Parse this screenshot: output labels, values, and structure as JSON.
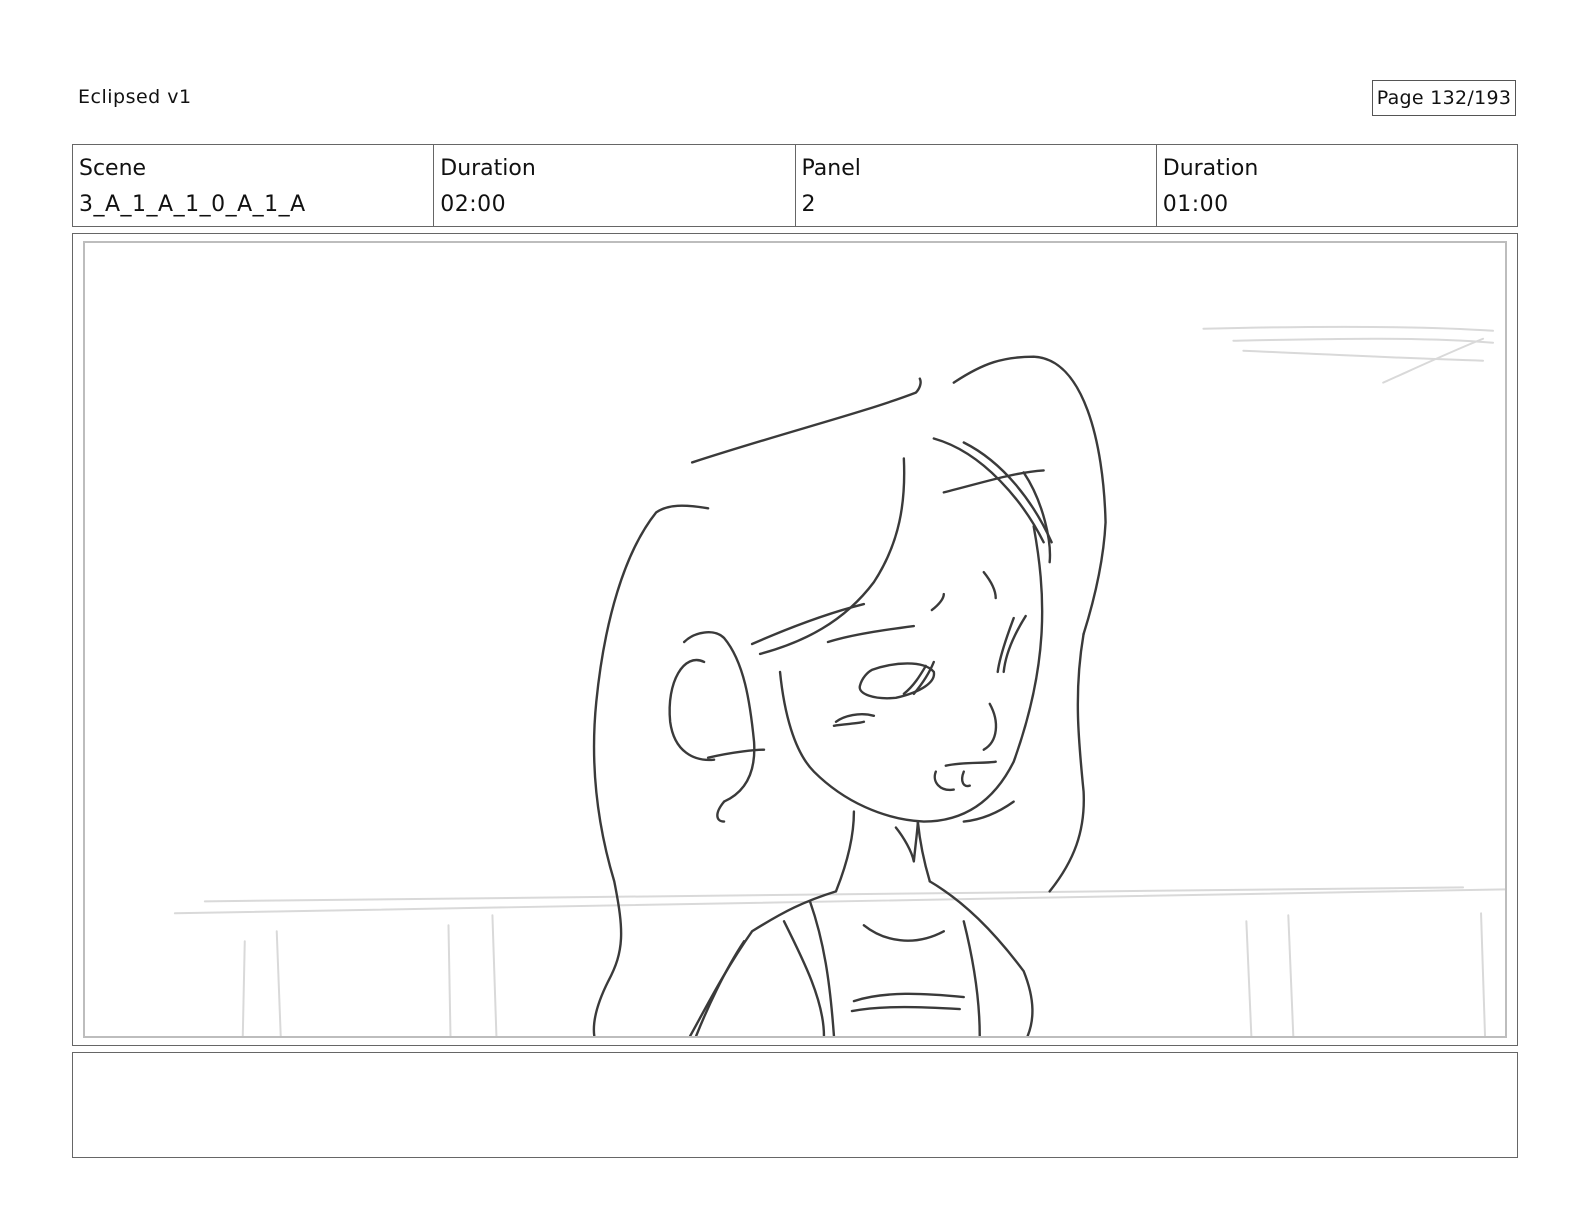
{
  "header": {
    "project_title": "Eclipsed v1",
    "page_indicator": "Page 132/193"
  },
  "info": {
    "scene_label": "Scene",
    "scene_value": "3_A_1_A_1_0_A_1_A",
    "scene_duration_label": "Duration",
    "scene_duration_value": "02:00",
    "panel_label": "Panel",
    "panel_value": "2",
    "panel_duration_label": "Duration",
    "panel_duration_value": "01:00"
  },
  "notes": {
    "text": ""
  },
  "colors": {
    "sketch_line": "#3a3a3a",
    "background_sketch": "#d9d9d9"
  }
}
